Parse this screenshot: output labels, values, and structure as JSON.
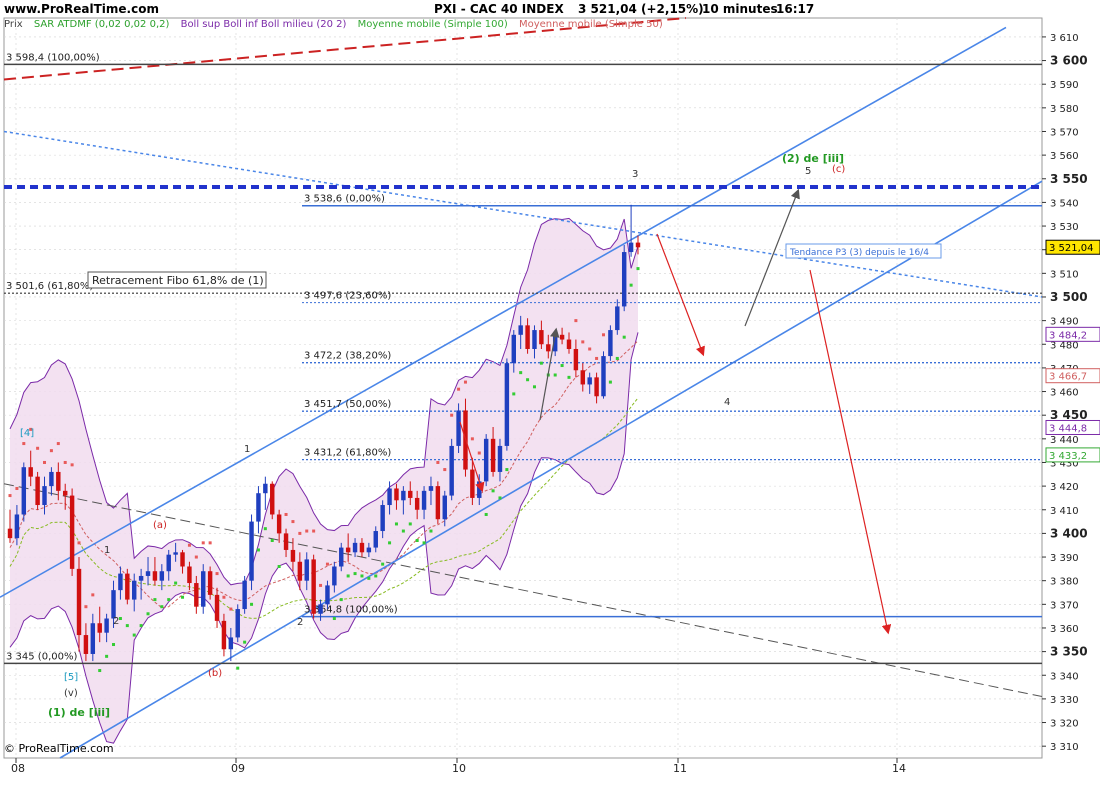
{
  "header": {
    "site": "www.ProRealTime.com",
    "title": "PXI - CAC 40 INDEX",
    "last": "3 521,04 (+2,15%)",
    "period": "10 minutes",
    "time": "16:17"
  },
  "footer": {
    "copyright": "© ProRealTime.com"
  },
  "legend": {
    "prix": "Prix",
    "items": [
      {
        "label": "SAR ATDMF (0,02 0,02 0,2)",
        "color": "#2ba02b"
      },
      {
        "label": "Boll sup Boll inf Boll milieu (20 2)",
        "color": "#7b2aa8"
      },
      {
        "label": "Moyenne mobile (Simple 100)",
        "color": "#33a833"
      },
      {
        "label": "Moyenne mobile (Simple 50)",
        "color": "#d06060"
      }
    ]
  },
  "colors": {
    "up": "#1f3fbf",
    "down": "#d01010",
    "channel": "#4a86e8",
    "fib": "#2255cc",
    "sar": "#33cc33",
    "sar_high": "#e85a5a",
    "boll": "#7b2aa8",
    "boll_fill": "#f1dcef",
    "ma100": "#88bb22",
    "ma50": "#d06060",
    "grid": "#d4d4d4",
    "redline": "#cc2222"
  },
  "chart_data": {
    "type": "candlestick",
    "instrument": "PXI - CAC 40 INDEX",
    "timeframe": "10 minutes",
    "x_ticks": [
      "08",
      "09",
      "10",
      "11",
      "14"
    ],
    "ylim": [
      3305,
      3618
    ],
    "y_ticks": [
      3310,
      3320,
      3330,
      3340,
      3350,
      3360,
      3370,
      3380,
      3390,
      3400,
      3410,
      3420,
      3430,
      3440,
      3450,
      3460,
      3470,
      3480,
      3490,
      3500,
      3510,
      3520,
      3530,
      3540,
      3550,
      3560,
      3570,
      3580,
      3590,
      3600,
      3610
    ],
    "y_tick_labels": [
      "3 310",
      "3 320",
      "3 330",
      "3 340",
      "3 350",
      "3 360",
      "3 370",
      "3 380",
      "3 390",
      "3 400",
      "3 410",
      "3 420",
      "3 430",
      "3 440",
      "3 450",
      "3 460",
      "3 470",
      "3 480",
      "3 490",
      "3 500",
      "3 510",
      "3 520",
      "3 530",
      "3 540",
      "3 550",
      "3 560",
      "3 570",
      "3 580",
      "3 590",
      "3 600",
      "3 610"
    ],
    "y_bold_ticks": [
      3350,
      3400,
      3450,
      3500,
      3550,
      3600
    ],
    "price_tags": [
      {
        "value": 3521.04,
        "label": "3 521,04",
        "bg": "#ffe600",
        "fg": "#000000"
      },
      {
        "value": 3484.2,
        "label": "3 484,2",
        "bg": "#ffffff",
        "fg": "#7b2aa8"
      },
      {
        "value": 3466.7,
        "label": "3 466,7",
        "bg": "#ffffff",
        "fg": "#d06060"
      },
      {
        "value": 3444.8,
        "label": "3 444,8",
        "bg": "#ffffff",
        "fg": "#7b2aa8"
      },
      {
        "value": 3433.2,
        "label": "3 433,2",
        "bg": "#ffffff",
        "fg": "#33a833"
      }
    ],
    "candles": [
      [
        3402,
        3410,
        3396,
        3398
      ],
      [
        3398,
        3412,
        3395,
        3408
      ],
      [
        3408,
        3430,
        3405,
        3428
      ],
      [
        3428,
        3435,
        3420,
        3424
      ],
      [
        3424,
        3426,
        3410,
        3412
      ],
      [
        3412,
        3424,
        3408,
        3420
      ],
      [
        3420,
        3428,
        3416,
        3426
      ],
      [
        3426,
        3430,
        3414,
        3418
      ],
      [
        3418,
        3421,
        3410,
        3416
      ],
      [
        3416,
        3419,
        3382,
        3385
      ],
      [
        3385,
        3390,
        3350,
        3357
      ],
      [
        3357,
        3362,
        3346,
        3349
      ],
      [
        3349,
        3366,
        3346,
        3362
      ],
      [
        3362,
        3369,
        3354,
        3358
      ],
      [
        3358,
        3366,
        3354,
        3364
      ],
      [
        3364,
        3380,
        3360,
        3376
      ],
      [
        3376,
        3386,
        3372,
        3383
      ],
      [
        3383,
        3385,
        3370,
        3372
      ],
      [
        3372,
        3383,
        3367,
        3380
      ],
      [
        3380,
        3385,
        3372,
        3382
      ],
      [
        3382,
        3390,
        3378,
        3384
      ],
      [
        3384,
        3390,
        3378,
        3380
      ],
      [
        3380,
        3387,
        3376,
        3384
      ],
      [
        3384,
        3393,
        3380,
        3391
      ],
      [
        3391,
        3396,
        3388,
        3392
      ],
      [
        3392,
        3393,
        3383,
        3386
      ],
      [
        3386,
        3388,
        3376,
        3379
      ],
      [
        3379,
        3382,
        3366,
        3369
      ],
      [
        3369,
        3387,
        3366,
        3384
      ],
      [
        3384,
        3386,
        3372,
        3374
      ],
      [
        3374,
        3377,
        3360,
        3363
      ],
      [
        3363,
        3366,
        3348,
        3351
      ],
      [
        3351,
        3360,
        3346,
        3356
      ],
      [
        3356,
        3370,
        3354,
        3368
      ],
      [
        3368,
        3382,
        3366,
        3380
      ],
      [
        3380,
        3408,
        3376,
        3405
      ],
      [
        3405,
        3420,
        3400,
        3417
      ],
      [
        3417,
        3424,
        3410,
        3421
      ],
      [
        3421,
        3422,
        3406,
        3408
      ],
      [
        3408,
        3410,
        3396,
        3400
      ],
      [
        3400,
        3402,
        3390,
        3393
      ],
      [
        3393,
        3398,
        3384,
        3388
      ],
      [
        3388,
        3392,
        3376,
        3380
      ],
      [
        3380,
        3392,
        3376,
        3389
      ],
      [
        3389,
        3391,
        3364,
        3366
      ],
      [
        3366,
        3372,
        3363,
        3370
      ],
      [
        3370,
        3380,
        3368,
        3378
      ],
      [
        3378,
        3388,
        3375,
        3386
      ],
      [
        3386,
        3396,
        3384,
        3394
      ],
      [
        3394,
        3400,
        3388,
        3392
      ],
      [
        3392,
        3398,
        3390,
        3396
      ],
      [
        3396,
        3398,
        3390,
        3392
      ],
      [
        3392,
        3396,
        3390,
        3394
      ],
      [
        3394,
        3403,
        3392,
        3401
      ],
      [
        3401,
        3414,
        3398,
        3412
      ],
      [
        3412,
        3422,
        3408,
        3419
      ],
      [
        3419,
        3421,
        3410,
        3414
      ],
      [
        3414,
        3420,
        3408,
        3418
      ],
      [
        3418,
        3422,
        3412,
        3415
      ],
      [
        3415,
        3418,
        3406,
        3410
      ],
      [
        3410,
        3420,
        3406,
        3418
      ],
      [
        3418,
        3424,
        3412,
        3420
      ],
      [
        3420,
        3422,
        3404,
        3406
      ],
      [
        3406,
        3418,
        3403,
        3416
      ],
      [
        3416,
        3440,
        3414,
        3437
      ],
      [
        3437,
        3455,
        3434,
        3452
      ],
      [
        3452,
        3457,
        3424,
        3427
      ],
      [
        3427,
        3432,
        3412,
        3415
      ],
      [
        3415,
        3425,
        3412,
        3422
      ],
      [
        3422,
        3442,
        3420,
        3440
      ],
      [
        3440,
        3445,
        3424,
        3426
      ],
      [
        3426,
        3440,
        3422,
        3437
      ],
      [
        3437,
        3474,
        3435,
        3472
      ],
      [
        3472,
        3486,
        3468,
        3484
      ],
      [
        3484,
        3492,
        3478,
        3488
      ],
      [
        3488,
        3491,
        3476,
        3478
      ],
      [
        3478,
        3488,
        3474,
        3486
      ],
      [
        3486,
        3490,
        3478,
        3480
      ],
      [
        3480,
        3484,
        3474,
        3477
      ],
      [
        3477,
        3486,
        3475,
        3484
      ],
      [
        3484,
        3487,
        3480,
        3482
      ],
      [
        3482,
        3485,
        3476,
        3478
      ],
      [
        3478,
        3482,
        3466,
        3469
      ],
      [
        3469,
        3472,
        3460,
        3463
      ],
      [
        3463,
        3468,
        3459,
        3466
      ],
      [
        3466,
        3468,
        3455,
        3458
      ],
      [
        3458,
        3477,
        3457,
        3475
      ],
      [
        3475,
        3488,
        3473,
        3486
      ],
      [
        3486,
        3499,
        3484,
        3496
      ],
      [
        3496,
        3522,
        3494,
        3519
      ],
      [
        3519,
        3539,
        3517,
        3523
      ],
      [
        3523,
        3526,
        3518,
        3521
      ]
    ],
    "channel_upper": {
      "x1": 0,
      "y1": 3373,
      "x2": 1006,
      "y2": 3614
    },
    "channel_lower": {
      "x1": 60,
      "y1": 3305,
      "x2": 1042,
      "y2": 3549
    },
    "horizontal_levels": [
      {
        "value": 3598.4,
        "label": "3 598,4 (100,00%)"
      },
      {
        "value": 3538.6,
        "label": "3 538,6 (0,00%)"
      },
      {
        "value": 3501.6,
        "label": "3 501,6 (61,80%)"
      },
      {
        "value": 3497.6,
        "label": "3 497,6 (23,60%)"
      },
      {
        "value": 3472.2,
        "label": "3 472,2 (38,20%)"
      },
      {
        "value": 3451.7,
        "label": "3 451,7 (50,00%)"
      },
      {
        "value": 3431.2,
        "label": "3 431,2 (61,80%)"
      },
      {
        "value": 3364.8,
        "label": "3 364,8 (100,00%)"
      },
      {
        "value": 3345,
        "label": "3 345 (0,00%)"
      }
    ],
    "annotations": {
      "retracement_box": "Retracement Fibo 61,8% de (1)",
      "trend_label": "Tendance P3 (3) depuis le 16/4",
      "wave_labels": [
        {
          "text": "(2) de [iii]",
          "color": "#229922"
        },
        {
          "text": "(c)",
          "color": "#cc2222"
        },
        {
          "text": "5",
          "color": "#333333"
        },
        {
          "text": "3",
          "color": "#333333"
        },
        {
          "text": "4",
          "color": "#333333"
        },
        {
          "text": "1",
          "color": "#333333"
        },
        {
          "text": "2",
          "color": "#333333"
        },
        {
          "text": "(a)",
          "color": "#cc2222"
        },
        {
          "text": "(b)",
          "color": "#cc2222"
        },
        {
          "text": "[5]",
          "color": "#1a9ac0"
        },
        {
          "text": "(v)",
          "color": "#333333"
        },
        {
          "text": "(1) de [iii]",
          "color": "#229922"
        },
        {
          "text": "[4]",
          "color": "#1a9ac0"
        }
      ]
    }
  }
}
